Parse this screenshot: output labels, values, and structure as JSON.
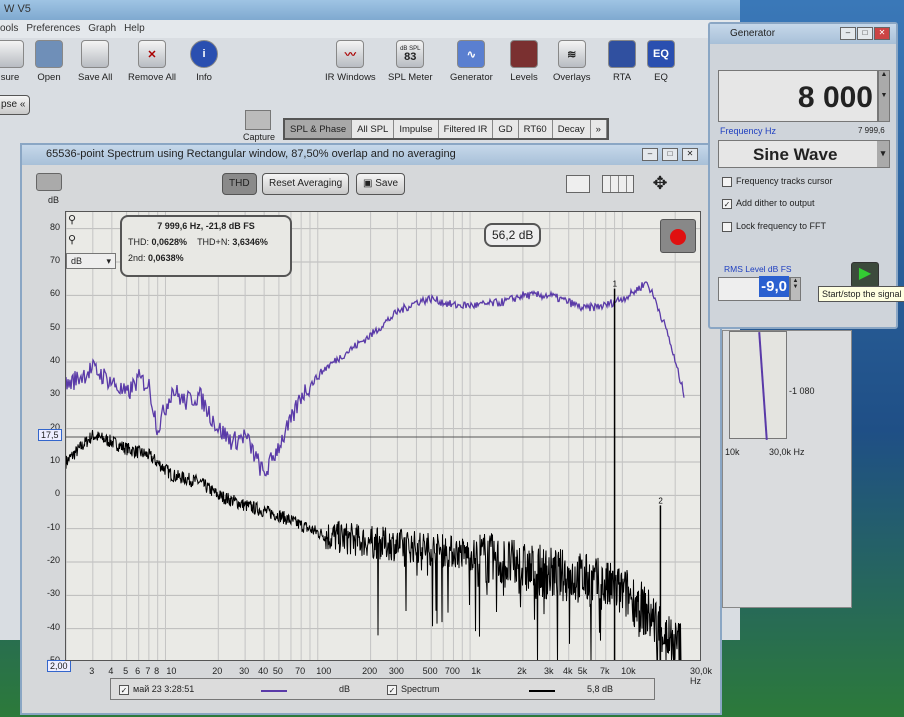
{
  "main": {
    "title": "W V5",
    "menu": [
      "ools",
      "Preferences",
      "Graph",
      "Help"
    ],
    "toolbar": [
      "sure",
      "Open",
      "Save All",
      "Remove All",
      "Info",
      "IR Windows",
      "SPL Meter",
      "Generator",
      "Levels",
      "Overlays",
      "RTA",
      "EQ"
    ],
    "spl_icon_value": "83",
    "spl_icon_unit": "dB SPL",
    "eq_icon": "EQ",
    "collapse": "pse «",
    "capture": "Capture",
    "tabs": [
      "SPL & Phase",
      "All SPL",
      "Impulse",
      "Filtered IR",
      "GD",
      "RT60",
      "Decay",
      "»"
    ]
  },
  "spectrum": {
    "title": "65536-point Spectrum using Rectangular window, 87,50% overlap and no averaging",
    "thd_button": "THD",
    "reset_button": "Reset Averaging",
    "save_button": "Save",
    "y_unit": "dB",
    "unit_select": "dB",
    "info": {
      "freq_line": "7 999,6 Hz, -21,8 dB FS",
      "thd_label": "THD:",
      "thd": "0,0628%",
      "thdn_label": "THD+N:",
      "thdn": "3,6346%",
      "second_label": "2nd:",
      "second": "0,0638%"
    },
    "level_readout": "56,2 dB",
    "cursor_value": "17,5",
    "x_start": "2,00",
    "legend": {
      "item1": "май 23 3:28:51",
      "item1_unit": "dB",
      "item2": "Spectrum",
      "item2_value": "5,8 dB"
    }
  },
  "generator": {
    "title": "Generator",
    "frequency": "8 000",
    "frequency_label": "Frequency Hz",
    "frequency_actual": "7 999,6",
    "waveform": "Sine Wave",
    "opt_track": "Frequency tracks cursor",
    "opt_dither": "Add dither to output",
    "opt_lock": "Lock frequency to FFT",
    "dither_checked": true,
    "rms_label": "RMS Level dB FS",
    "rms_value": "-9,0",
    "tooltip": "Start/stop the signal"
  },
  "background": {
    "ytick": "-1 080",
    "xticks": [
      "10k",
      "30,0k Hz"
    ]
  },
  "chart_data": {
    "type": "line",
    "xscale": "log",
    "xlim": [
      2,
      30000
    ],
    "ylim": [
      -50,
      85
    ],
    "ylabel": "dB",
    "xlabel": "Hz",
    "yticks": [
      80,
      70,
      60,
      50,
      40,
      30,
      20,
      10,
      0,
      -10,
      -20,
      -30,
      -40,
      -50
    ],
    "xticks": [
      {
        "v": 3,
        "l": "3"
      },
      {
        "v": 4,
        "l": "4"
      },
      {
        "v": 5,
        "l": "5"
      },
      {
        "v": 6,
        "l": "6"
      },
      {
        "v": 7,
        "l": "7"
      },
      {
        "v": 8,
        "l": "8"
      },
      {
        "v": 10,
        "l": "10"
      },
      {
        "v": 20,
        "l": "20"
      },
      {
        "v": 30,
        "l": "30"
      },
      {
        "v": 40,
        "l": "40"
      },
      {
        "v": 50,
        "l": "50"
      },
      {
        "v": 70,
        "l": "70"
      },
      {
        "v": 100,
        "l": "100"
      },
      {
        "v": 200,
        "l": "200"
      },
      {
        "v": 300,
        "l": "300"
      },
      {
        "v": 500,
        "l": "500"
      },
      {
        "v": 700,
        "l": "700"
      },
      {
        "v": 1000,
        "l": "1k"
      },
      {
        "v": 2000,
        "l": "2k"
      },
      {
        "v": 3000,
        "l": "3k"
      },
      {
        "v": 4000,
        "l": "4k"
      },
      {
        "v": 5000,
        "l": "5k"
      },
      {
        "v": 7000,
        "l": "7k"
      },
      {
        "v": 10000,
        "l": "10k"
      },
      {
        "v": 30000,
        "l": "30,0k Hz"
      }
    ],
    "series": [
      {
        "name": "май 23 3:28:51",
        "color": "#5a3aa8",
        "x": [
          2,
          3,
          4,
          5,
          6,
          7,
          8,
          10,
          12,
          15,
          20,
          25,
          30,
          40,
          50,
          60,
          70,
          100,
          150,
          200,
          300,
          400,
          500,
          700,
          1000,
          1500,
          2000,
          3000,
          4000,
          5000,
          7000,
          10000,
          13000,
          15000,
          18000,
          20000,
          23000
        ],
        "y": [
          33,
          38,
          34,
          30,
          35,
          33,
          20,
          32,
          28,
          30,
          20,
          16,
          18,
          6,
          15,
          22,
          30,
          38,
          44,
          48,
          55,
          58,
          59,
          57,
          57,
          58,
          60,
          60,
          58,
          56,
          57,
          60,
          64,
          58,
          48,
          40,
          30
        ]
      },
      {
        "name": "Spectrum",
        "color": "#000000",
        "x": [
          2,
          3,
          4,
          5,
          7,
          10,
          15,
          20,
          30,
          50,
          70,
          100,
          200,
          500,
          1000,
          2000,
          5000,
          10000,
          15000,
          20000
        ],
        "y": [
          10,
          18,
          16,
          14,
          12,
          6,
          4,
          0,
          -3,
          -6,
          -9,
          -12,
          -14,
          -16,
          -18,
          -22,
          -25,
          -30,
          -38,
          -45
        ]
      }
    ],
    "peaks": [
      {
        "label": "1",
        "x": 7999.6,
        "y": 62
      },
      {
        "label": "2",
        "x": 16000,
        "y": -3
      }
    ]
  }
}
